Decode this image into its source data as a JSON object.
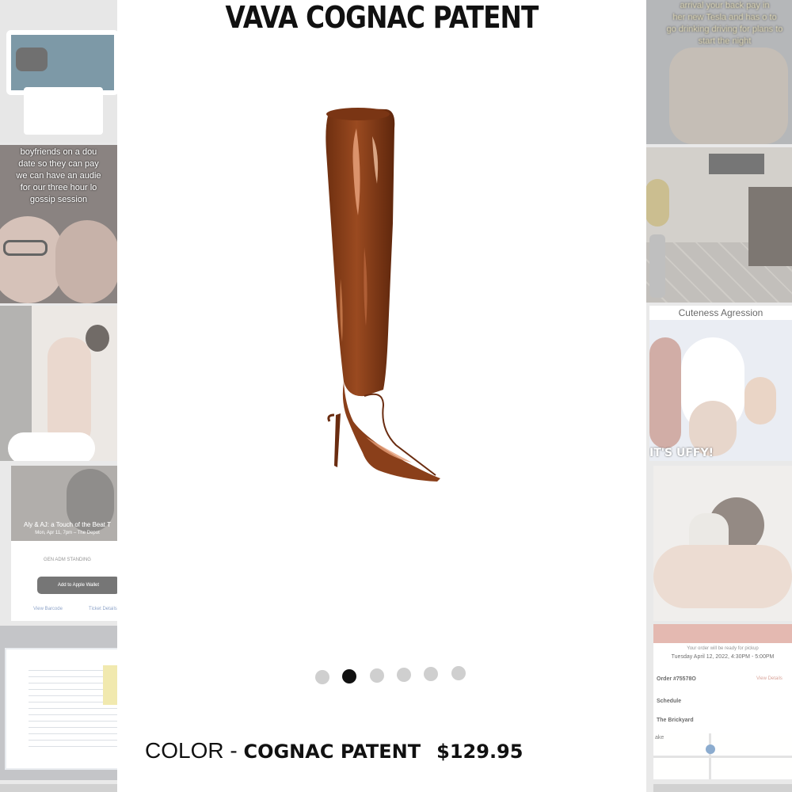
{
  "product": {
    "title": "VAVA COGNAC PATENT",
    "color_label": "COLOR - ",
    "color_name": "COGNAC PATENT",
    "price": "$129.95",
    "image_icon": "over-the-knee-boot-icon",
    "carousel": {
      "count": 6,
      "active_index": 1
    }
  },
  "colors": {
    "boot": "#8a3f1a",
    "boot_highlight": "#d98a5a",
    "dot_active": "#111111",
    "dot_inactive": "#cfcfcf"
  },
  "background_thumbnails": {
    "left": [
      {
        "name": "toilet-tank-thumbnail"
      },
      {
        "name": "double-date-thumbnail",
        "caption": [
          "boyfriends on a dou",
          "date so they can pay",
          "we can have an audie",
          "for our three hour lo",
          "gossip session"
        ]
      },
      {
        "name": "mirror-selfie-thumbnail"
      },
      {
        "name": "ticket-thumbnail",
        "event": "Aly & AJ: a Touch of the Beat T",
        "event_date": "Mon, Apr 11, 7pm – The Depot",
        "ticket_type": "GEN ADM STANDING",
        "wallet_button": "Add to Apple Wallet",
        "link_barcode": "View Barcode",
        "link_details": "Ticket Details"
      },
      {
        "name": "spreadsheet-thumbnail"
      }
    ],
    "right": [
      {
        "name": "blurry-text-thumbnail",
        "caption": [
          "arrival your back pay in",
          "her new Tesla and has o to",
          "go drinking driving for plans to",
          "start the night"
        ]
      },
      {
        "name": "dining-room-thumbnail"
      },
      {
        "name": "cartoon-thumbnail",
        "header": "Cuteness Agression",
        "footer": "IT'S          UFFY!"
      },
      {
        "name": "hair-scrunchie-thumbnail"
      },
      {
        "name": "order-thumbnail",
        "ready_text": "Your order will be ready for pickup",
        "pickup_time": "Tuesday April 12, 2022, 4:30PM - 5:00PM",
        "order_label": "Order #75578O",
        "view_details": "View Details",
        "schedule_label": "Schedule",
        "location_label": "The Brickyard",
        "map_city": "ake"
      }
    ]
  }
}
